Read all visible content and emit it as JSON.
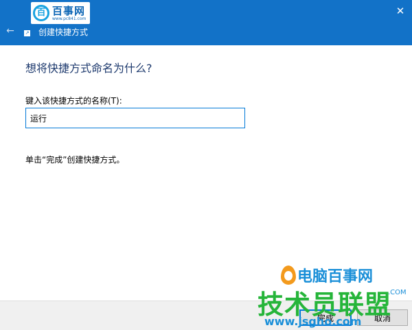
{
  "titlebar": {
    "title": "创建快捷方式",
    "back_icon": "arrow-left-icon",
    "close_glyph": "✕",
    "background": "#1272c8"
  },
  "watermark_top": {
    "brand": "百事网",
    "badge": "百",
    "domain": "www.pc841.com"
  },
  "content": {
    "heading": "想将快捷方式命名为什么?",
    "field_label": "键入该快捷方式的名称(T):",
    "field_value": "运行",
    "hint": "单击“完成”创建快捷方式。"
  },
  "footer": {
    "finish_label": "完成",
    "cancel_label": "取消"
  },
  "watermark_bottom": {
    "title": "电脑百事网",
    "subtitle": "技术员联盟",
    "com": ".COM",
    "url": "www.jsgho.com"
  }
}
